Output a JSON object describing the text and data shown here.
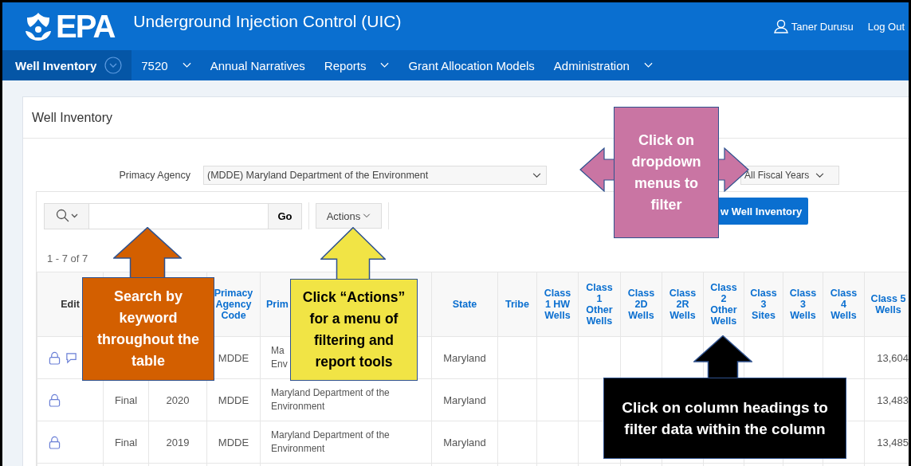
{
  "header": {
    "logo_text": "EPA",
    "title": "Underground Injection Control (UIC)",
    "user": "Taner Durusu",
    "logout": "Log Out"
  },
  "nav": [
    {
      "label": "Well Inventory",
      "selected": true,
      "has_menu": true
    },
    {
      "label": "7520",
      "selected": false,
      "has_menu": true
    },
    {
      "label": "Annual Narratives",
      "selected": false,
      "has_menu": false
    },
    {
      "label": "Reports",
      "selected": false,
      "has_menu": true
    },
    {
      "label": "Grant Allocation Models",
      "selected": false,
      "has_menu": false
    },
    {
      "label": "Administration",
      "selected": false,
      "has_menu": true
    }
  ],
  "card": {
    "title": "Well Inventory"
  },
  "filters": {
    "agency_label": "Primacy Agency",
    "agency_value": "(MDDE) Maryland Department of the Environment",
    "fiscal_year_value": "All Fiscal Years"
  },
  "toolbar": {
    "go": "Go",
    "actions": "Actions",
    "new_button": "w Well Inventory"
  },
  "pagination": "1 - 7 of 7",
  "table": {
    "edit_column": {
      "label": "Edit"
    },
    "columns": [
      {
        "kind": "covered"
      },
      {
        "kind": "covered"
      },
      {
        "kind": "link",
        "label": "Primacy Agency Code"
      },
      {
        "kind": "link",
        "label": "Prim"
      },
      {
        "kind": "link",
        "label": "State"
      },
      {
        "kind": "link",
        "label": "Tribe"
      },
      {
        "kind": "link",
        "label": "Class 1 HW Wells"
      },
      {
        "kind": "link",
        "label": "Class 1 Other Wells"
      },
      {
        "kind": "link",
        "label": "Class 2D Wells"
      },
      {
        "kind": "link",
        "label": "Class 2R Wells"
      },
      {
        "kind": "link",
        "label": "Class 2 Other Wells"
      },
      {
        "kind": "link",
        "label": "Class 3 Sites"
      },
      {
        "kind": "link",
        "label": "Class 3 Wells"
      },
      {
        "kind": "link",
        "label": "Class 4 Wells"
      },
      {
        "kind": "link",
        "label": "Class 5 Wells"
      }
    ],
    "rows": [
      {
        "lock": true,
        "comment": true,
        "cells": [
          null,
          null,
          "MDDE",
          "Ma\nEnv",
          "Maryland",
          null,
          null,
          null,
          null,
          null,
          null,
          null,
          null,
          null,
          "13,604"
        ]
      },
      {
        "lock": true,
        "comment": false,
        "cells": [
          "Final",
          "2020",
          "MDDE",
          "Maryland Department of the Environment",
          "Maryland",
          null,
          null,
          null,
          null,
          null,
          null,
          null,
          null,
          null,
          "13,483"
        ]
      },
      {
        "lock": true,
        "comment": false,
        "cells": [
          "Final",
          "2019",
          "MDDE",
          "Maryland Department of the Environment",
          "Maryland",
          null,
          null,
          null,
          null,
          null,
          null,
          null,
          null,
          null,
          "13,485"
        ]
      },
      {
        "lock": false,
        "comment": false,
        "cells": [
          null,
          null,
          null,
          null,
          null,
          null,
          null,
          null,
          null,
          null,
          null,
          null,
          null,
          null,
          null
        ]
      }
    ]
  },
  "callouts": [
    {
      "kind": "up",
      "color": "#d35f00",
      "text": "Search by\nkeyword\nthroughout the\ntable"
    },
    {
      "kind": "up",
      "color": "#f1e445",
      "text": "Click “Actions”\nfor a menu of\nfiltering and\nreport tools"
    },
    {
      "kind": "double",
      "color": "#c975a3",
      "text": "Click on\ndropdown\nmenus to\nfilter"
    },
    {
      "kind": "up",
      "color": "#000000",
      "text": "Click on column headings to\nfilter data within the column"
    }
  ]
}
